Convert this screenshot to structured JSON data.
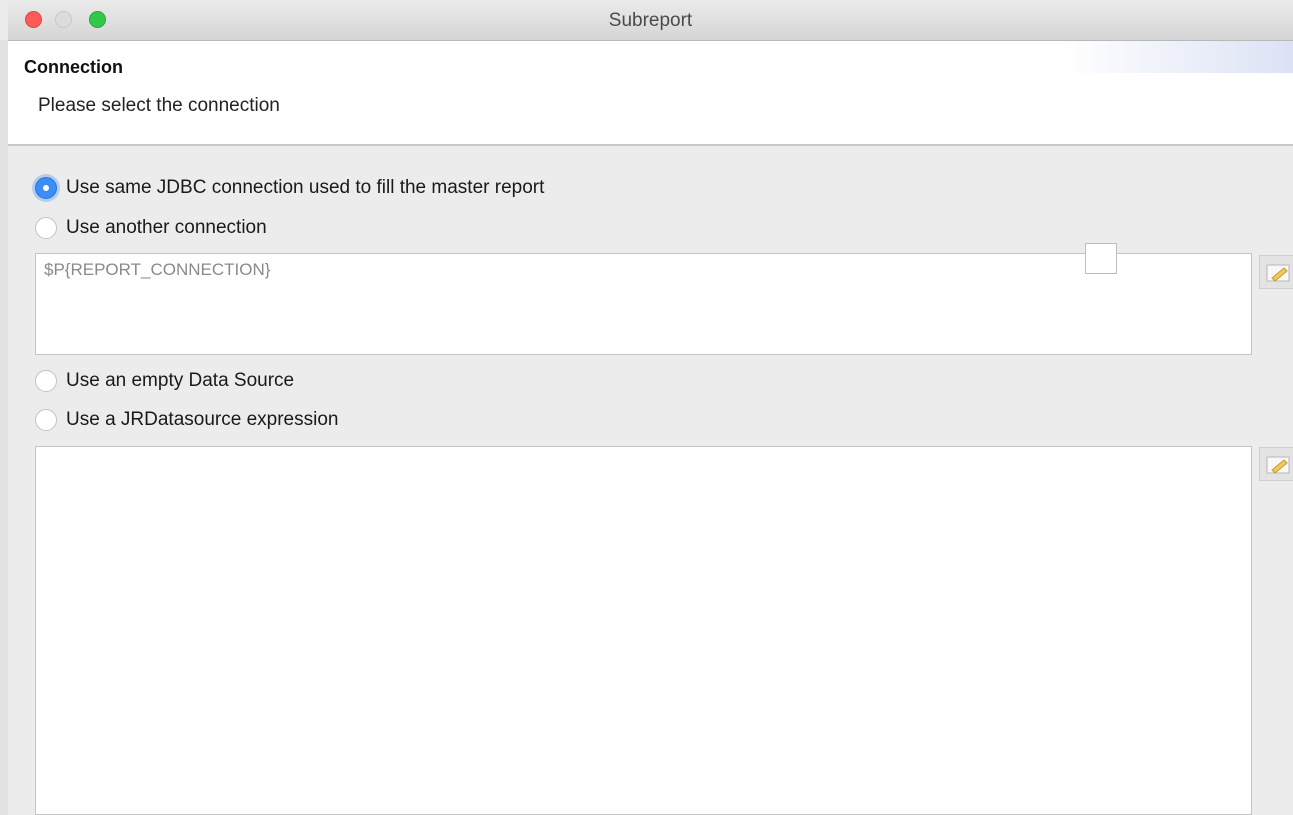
{
  "window": {
    "title": "Subreport"
  },
  "header": {
    "title": "Connection",
    "description": "Please select the connection"
  },
  "options": [
    {
      "label": "Use same JDBC connection used to fill the master report",
      "checked": true
    },
    {
      "label": "Use another connection",
      "checked": false
    },
    {
      "label": "Use an empty Data Source",
      "checked": false
    },
    {
      "label": "Use a JRDatasource expression",
      "checked": false
    }
  ],
  "connection_expression": {
    "value": "$P{REPORT_CONNECTION}"
  },
  "datasource_expression": {
    "value": ""
  },
  "icons": {
    "edit": "pencil-icon"
  },
  "colors": {
    "accent": "#3a8ef6",
    "close": "#fc5b57",
    "maximize": "#34c84a"
  }
}
